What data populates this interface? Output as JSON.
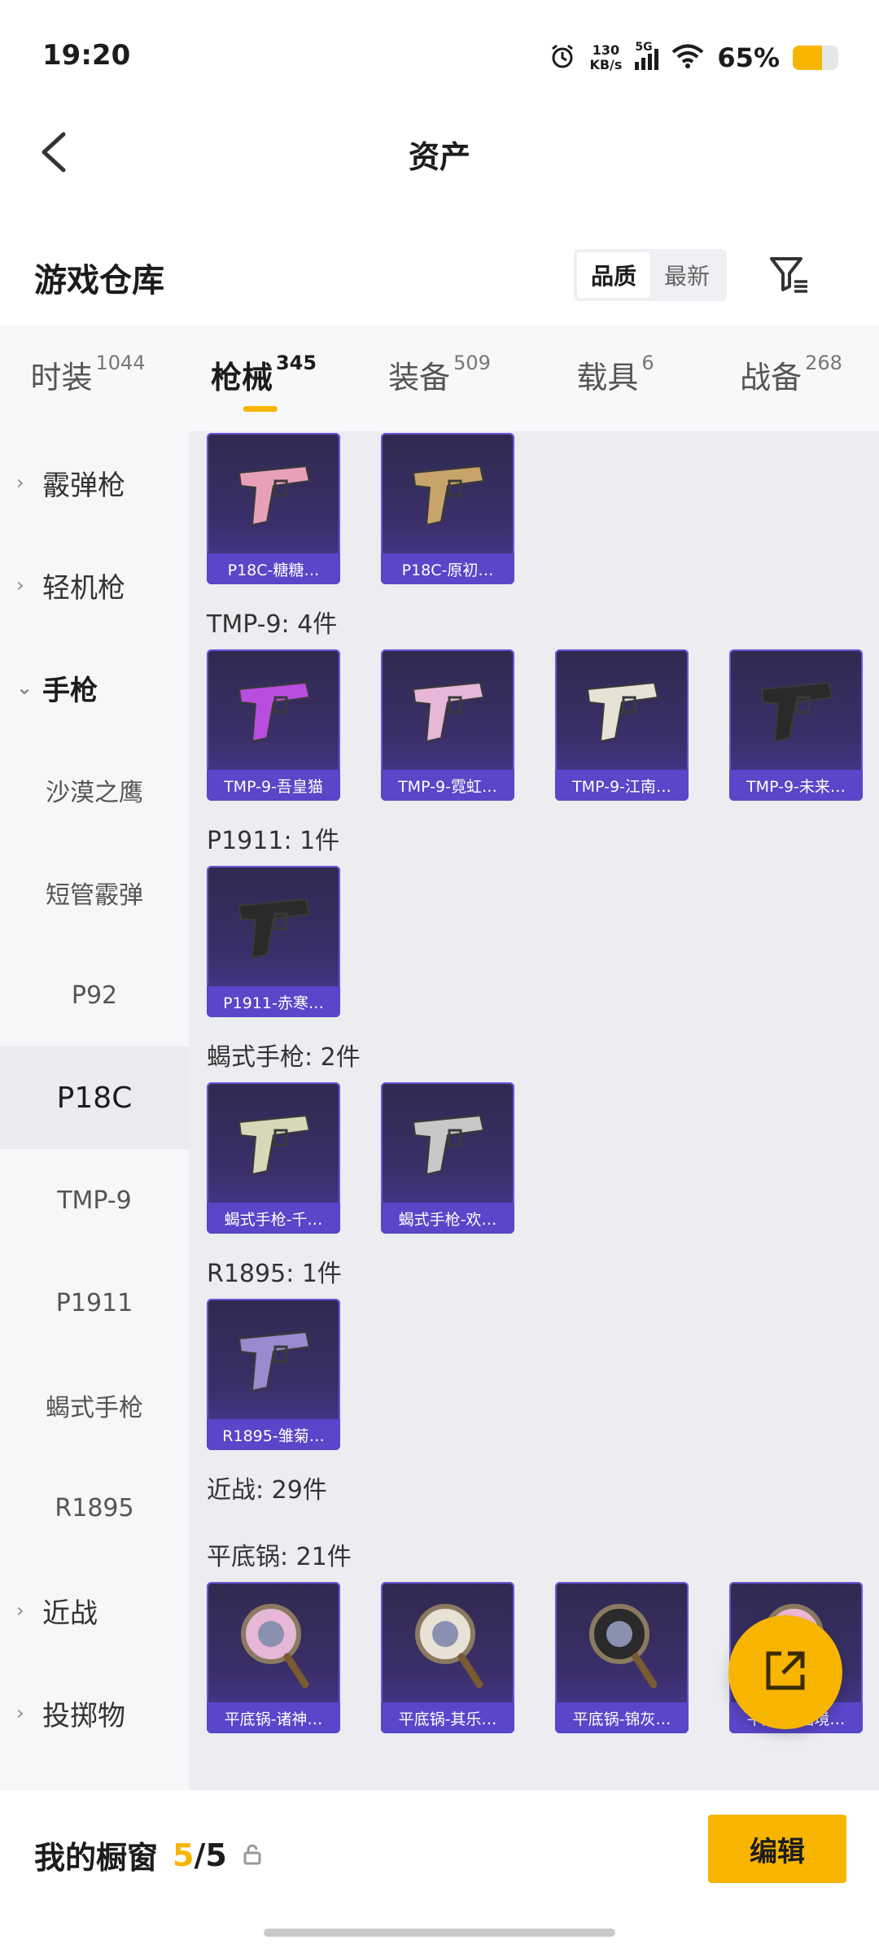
{
  "status_bar": {
    "time": "19:20",
    "net_speed_value": "130",
    "net_speed_unit": "KB/s",
    "network": "5G",
    "battery_percent_text": "65%",
    "battery_level": 0.65
  },
  "header": {
    "title": "资产"
  },
  "warehouse": {
    "title": "游戏仓库",
    "sort_options": [
      "品质",
      "最新"
    ],
    "active_sort": "品质"
  },
  "tabs": [
    {
      "label": "时装",
      "count": "1044"
    },
    {
      "label": "枪械",
      "count": "345",
      "active": true
    },
    {
      "label": "装备",
      "count": "509"
    },
    {
      "label": "载具",
      "count": "6"
    },
    {
      "label": "战备",
      "count": "268"
    }
  ],
  "sidebar": {
    "items": [
      {
        "label": "霰弹枪",
        "kind": "category",
        "chevron": "›"
      },
      {
        "label": "轻机枪",
        "kind": "category",
        "chevron": "›"
      },
      {
        "label": "手枪",
        "kind": "category-open",
        "chevron": "⌄"
      },
      {
        "label": "沙漠之鹰",
        "kind": "sub"
      },
      {
        "label": "短管霰弹",
        "kind": "sub"
      },
      {
        "label": "P92",
        "kind": "sub"
      },
      {
        "label": "P18C",
        "kind": "sub",
        "selected": true
      },
      {
        "label": "TMP-9",
        "kind": "sub"
      },
      {
        "label": "P1911",
        "kind": "sub"
      },
      {
        "label": "蝎式手枪",
        "kind": "sub"
      },
      {
        "label": "R1895",
        "kind": "sub"
      },
      {
        "label": "近战",
        "kind": "category",
        "chevron": "›"
      },
      {
        "label": "投掷物",
        "kind": "category",
        "chevron": "›"
      }
    ]
  },
  "content": {
    "groups": [
      {
        "label": "",
        "items": [
          "P18C-糖糖…",
          "P18C-原初…"
        ]
      },
      {
        "label": "TMP-9: 4件",
        "items": [
          "TMP-9-吾皇猫",
          "TMP-9-霓虹…",
          "TMP-9-江南…",
          "TMP-9-未来…"
        ]
      },
      {
        "label": "P1911: 1件",
        "items": [
          "P1911-赤寒…"
        ]
      },
      {
        "label": "蝎式手枪: 2件",
        "items": [
          "蝎式手枪-千…",
          "蝎式手枪-欢…"
        ]
      },
      {
        "label": "R1895: 1件",
        "items": [
          "R1895-雏菊…"
        ]
      },
      {
        "label": "近战: 29件",
        "items": []
      },
      {
        "label": "平底锅: 21件",
        "items": [
          "平底锅-诸神…",
          "平底锅-其乐…",
          "平底锅-锦灰…",
          "平底锅-画境…"
        ]
      }
    ]
  },
  "bottom_bar": {
    "label": "我的橱窗",
    "count_current": "5",
    "count_total": "/5",
    "edit_label": "编辑"
  }
}
